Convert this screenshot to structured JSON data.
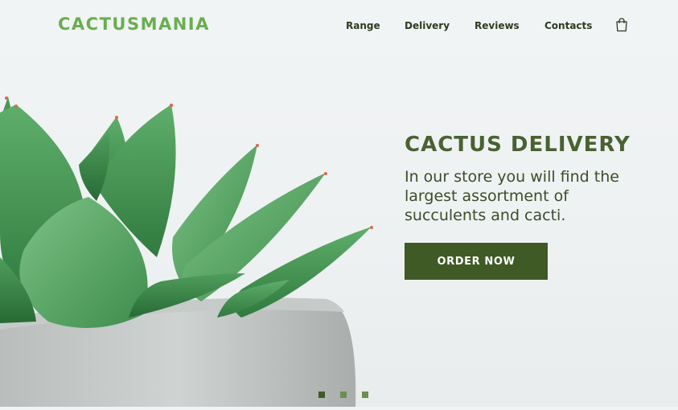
{
  "brand": {
    "logo": "CACTUSMANIA"
  },
  "nav": {
    "items": [
      {
        "label": "Range"
      },
      {
        "label": "Delivery"
      },
      {
        "label": "Reviews"
      },
      {
        "label": "Contacts"
      }
    ],
    "cart_icon": "shopping-bag-icon"
  },
  "hero": {
    "title": "CACTUS DELIVERY",
    "subtitle": "In our store you will find the largest assortment of succulents and cacti.",
    "cta_label": "ORDER NOW",
    "image": "succulent-in-concrete-pot"
  },
  "slider": {
    "count": 3,
    "active_index": 0
  },
  "colors": {
    "brand_green": "#6aae4f",
    "dark_green": "#4a6131",
    "button_green": "#3f5a25",
    "nav_text": "#2f3a22",
    "background": "#f1f4f5"
  }
}
